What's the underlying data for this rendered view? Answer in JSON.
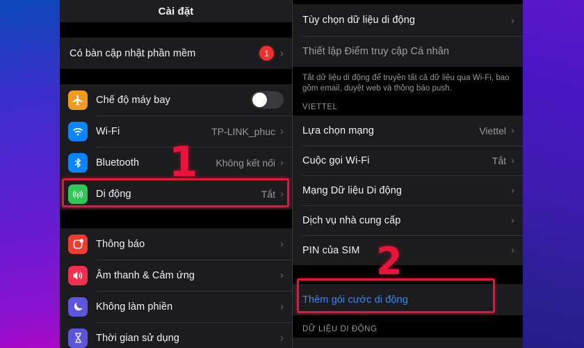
{
  "left_panel": {
    "nav_title": "Cài đặt",
    "update_row": {
      "label": "Có bàn cập nhật phần mềm",
      "badge": "1",
      "chevron": "›"
    },
    "group_connectivity": [
      {
        "label": "Chế độ máy bay",
        "icon": "airplane-icon",
        "control": "toggle",
        "toggle_on": false,
        "color": "#f09a20"
      },
      {
        "label": "Wi-Fi",
        "icon": "wifi-icon",
        "value": "TP-LINK_phuc",
        "chevron": "›",
        "color": "#0a84ff"
      },
      {
        "label": "Bluetooth",
        "icon": "bluetooth-icon",
        "value": "Không kết nối",
        "chevron": "›",
        "color": "#0a84ff"
      },
      {
        "label": "Di động",
        "icon": "cellular-icon",
        "value": "Tắt",
        "chevron": "›",
        "color": "#32c759"
      }
    ],
    "group_system": [
      {
        "label": "Thông báo",
        "icon": "notifications-icon",
        "chevron": "›",
        "color": "#f03c2e"
      },
      {
        "label": "Âm thanh & Cảm ứng",
        "icon": "sound-haptics-icon",
        "chevron": "›",
        "color": "#f0304e"
      },
      {
        "label": "Không làm phiền",
        "icon": "do-not-disturb-icon",
        "chevron": "›",
        "color": "#5c56dc"
      },
      {
        "label": "Thời gian sử dụng",
        "icon": "screen-time-icon",
        "chevron": "›",
        "color": "#5c56dc"
      }
    ]
  },
  "right_panel": {
    "top_rows": [
      {
        "label": "Tùy chọn dữ liệu di động",
        "chevron": "›",
        "dim": false
      },
      {
        "label": "Thiết lập Điểm truy cập Cá nhân",
        "chevron": "",
        "dim": true
      }
    ],
    "footnote": "Tắt dữ liệu di động để truyền tất cả dữ liệu qua Wi-Fi, bao gồm email, duyệt web và thông báo push.",
    "carrier_header": "VIETTEL",
    "carrier_rows": [
      {
        "label": "Lựa chọn mạng",
        "value": "Viettel",
        "chevron": "›"
      },
      {
        "label": "Cuộc gọi Wi-Fi",
        "value": "Tắt",
        "chevron": "›"
      },
      {
        "label": "Mạng Dữ liệu Di động",
        "value": "",
        "chevron": "›"
      },
      {
        "label": "Dịch vụ nhà cung cấp",
        "value": "",
        "chevron": "›"
      },
      {
        "label": "PIN của SIM",
        "value": "",
        "chevron": "›"
      }
    ],
    "add_plan_row": {
      "label": "Thêm gói cước di động"
    },
    "data_header": "DỮ LIỆU DI ĐỘNG"
  },
  "annotations": [
    {
      "name": "step-1",
      "text": "1"
    },
    {
      "name": "step-2",
      "text": "2"
    }
  ],
  "colors": {
    "accent_red": "#e8143c",
    "link_blue": "#3b86f0",
    "badge_red": "#f03030"
  }
}
